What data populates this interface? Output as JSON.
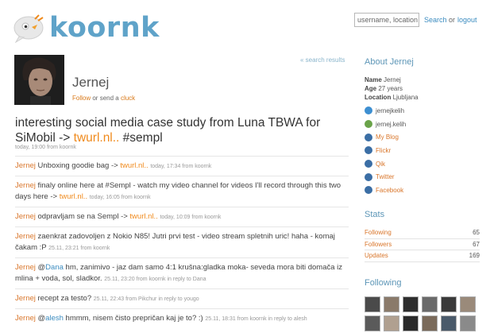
{
  "header": {
    "logo_text": "koornk",
    "search_placeholder": "username, location",
    "search_label": "Search",
    "or_label": "or",
    "logout_label": "logout"
  },
  "back_link": "« search results",
  "profile": {
    "name": "Jernej",
    "follow_label": "Follow",
    "or_send_label": "or send a",
    "cluck_label": "cluck"
  },
  "main_status": {
    "text": "interesting social media case study from Luna TBWA for SiMobil -> ",
    "link": "twurl.nl..",
    "tag": " #sempl",
    "meta": "today, 19:00 from koornk"
  },
  "timeline": [
    {
      "user": "Jernej",
      "pre": " Unboxing goodie bag -> ",
      "link": "twurl.nl..",
      "post": "",
      "meta": "today, 17:34 from koornk"
    },
    {
      "user": "Jernej",
      "pre": " finaly online here at #Sempl - watch my video channel for videos I'll record through this two days here -> ",
      "link": "twurl.nl..",
      "post": "",
      "meta": "today, 16:05 from koornk"
    },
    {
      "user": "Jernej",
      "pre": " odpravljam se na Sempl -> ",
      "link": "twurl.nl..",
      "post": "",
      "meta": "today, 10:09 from koornk"
    },
    {
      "user": "Jernej",
      "pre": " zaenkrat zadovoljen z Nokio N85! Jutri prvi test - video stream spletnih uric! haha - komaj čakam :P ",
      "link": "",
      "post": "",
      "meta": "25.11, 23:21 from koornk"
    },
    {
      "user": "Jernej",
      "pre": " @",
      "mention": "Dana",
      "post": " hm, zanimivo - jaz dam samo 4:1 krušna:gladka moka- seveda mora biti domača iz mlina + voda, sol, sladkor. ",
      "meta": "25.11, 23:20 from koornk in reply to Dana"
    },
    {
      "user": "Jernej",
      "pre": " recept za testo? ",
      "link": "",
      "post": "",
      "meta": "25.11, 22:43 from Pikchur in reply to yougo"
    },
    {
      "user": "Jernej",
      "pre": " @",
      "mention": "alesh",
      "post": " hmmm, nisem čisto prepričan kaj je to? :) ",
      "meta": "25.11, 18:31 from koornk in reply to alesh"
    }
  ],
  "about": {
    "title": "About Jernej",
    "name_label": "Name",
    "name_value": "Jernej",
    "age_label": "Age",
    "age_value": "27 years",
    "location_label": "Location",
    "location_value": "Ljubljana",
    "accounts": [
      {
        "icon": "skype-icon",
        "label": "jernejkelih",
        "color": "#3d8fd1",
        "link": false
      },
      {
        "icon": "msn-icon",
        "label": "jernej.kelih",
        "color": "#6aa34a",
        "link": false
      },
      {
        "icon": "blog-icon",
        "label": "My Blog",
        "color": "#3b6ea5",
        "link": true
      },
      {
        "icon": "flickr-icon",
        "label": "Flickr",
        "color": "#3b6ea5",
        "link": true
      },
      {
        "icon": "qik-icon",
        "label": "Qik",
        "color": "#3b6ea5",
        "link": true
      },
      {
        "icon": "twitter-icon",
        "label": "Twitter",
        "color": "#3b6ea5",
        "link": true
      },
      {
        "icon": "facebook-icon",
        "label": "Facebook",
        "color": "#3b6ea5",
        "link": true
      }
    ]
  },
  "stats": {
    "title": "Stats",
    "rows": [
      {
        "label": "Following",
        "value": "65"
      },
      {
        "label": "Followers",
        "value": "67"
      },
      {
        "label": "Updates",
        "value": "169"
      }
    ]
  },
  "following": {
    "title": "Following",
    "avatar_colors": [
      "#4a4a4a",
      "#8a7a6a",
      "#2e2e2e",
      "#6a6a6a",
      "#3a3a3a",
      "#9a8a7a",
      "#5a5a5a",
      "#b0a090",
      "#2a2a2a",
      "#7a6a5a",
      "#4a5a6a",
      "#8a8a8a"
    ]
  },
  "colors": {
    "brand_blue": "#5fa3c9",
    "accent_orange": "#d9762b",
    "link_orange": "#f08a1c"
  }
}
